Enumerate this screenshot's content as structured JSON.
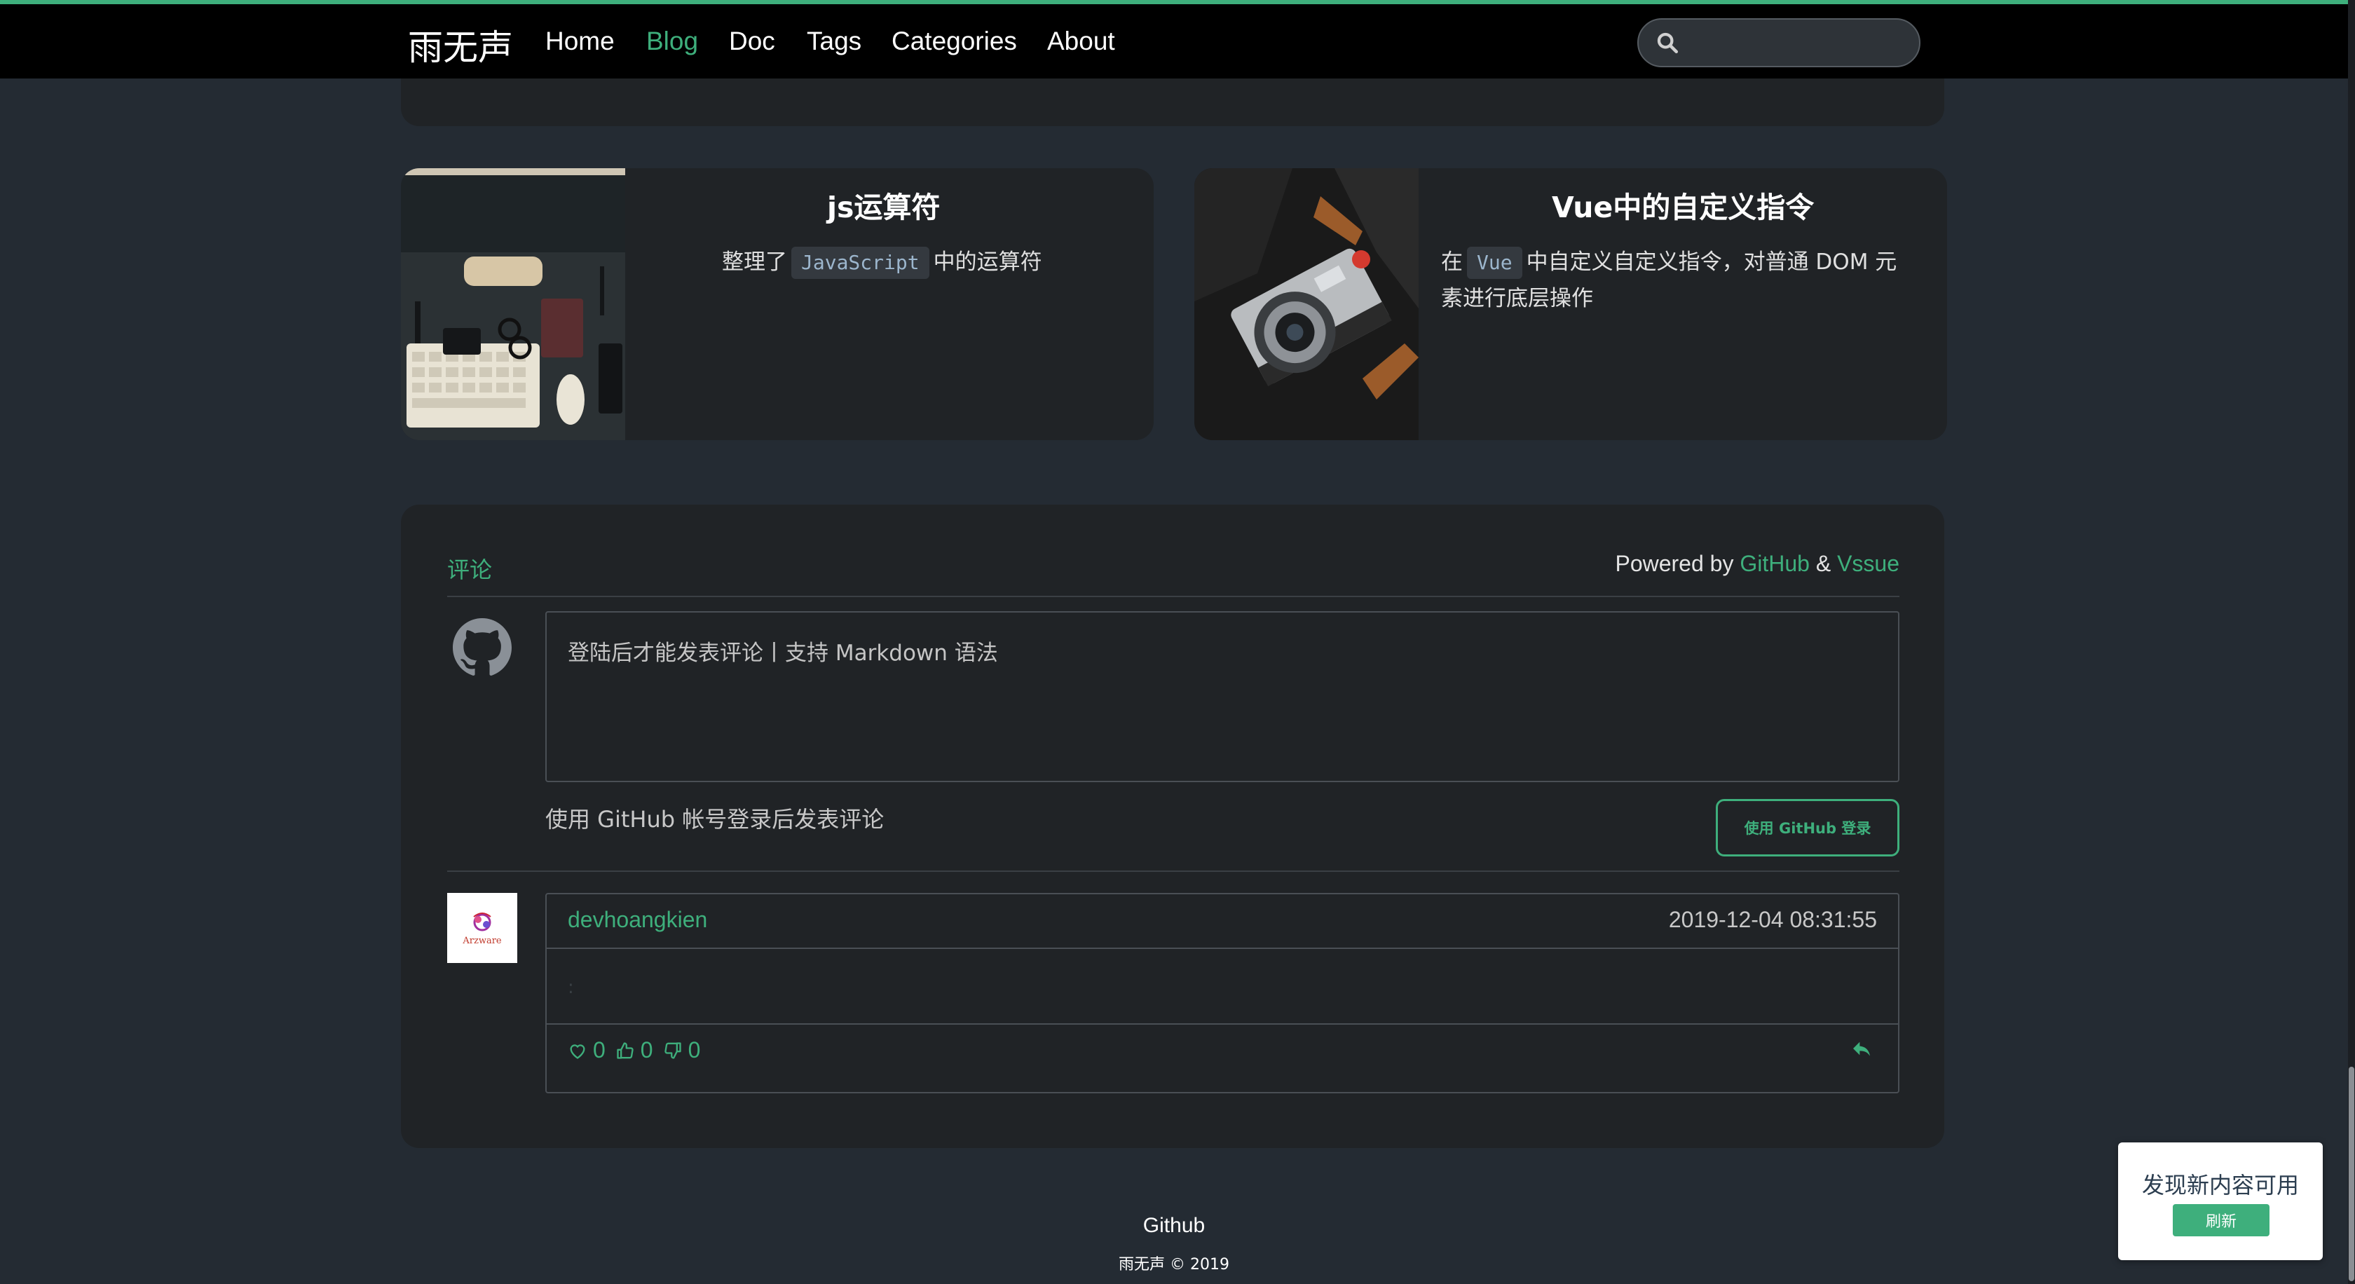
{
  "nav": {
    "brand": "雨无声",
    "links": [
      "Home",
      "Blog",
      "Doc",
      "Tags",
      "Categories",
      "About"
    ],
    "active": "Blog",
    "search_placeholder": ""
  },
  "posts": [
    {
      "title": "js运算符",
      "desc_before": "整理了",
      "code": "JavaScript",
      "desc_after": "中的运算符"
    },
    {
      "title": "Vue中的自定义指令",
      "desc_before": "在",
      "code": "Vue",
      "desc_after": "中自定义自定义指令，对普通 DOM 元素进行底层操作"
    }
  ],
  "comments": {
    "header": "评论",
    "powered_prefix": "Powered by",
    "powered_github": "GitHub",
    "powered_amp": "&",
    "powered_vssue": "Vssue",
    "textarea_placeholder": "登陆后才能发表评论丨支持 Markdown 语法",
    "tip": "使用 GitHub 帐号登录后发表评论",
    "login_button": "使用 GitHub 登录",
    "items": [
      {
        "author": "devhoangkien",
        "time": "2019-12-04 08:31:55",
        "body": ":",
        "hearts": "0",
        "likes": "0",
        "dislikes": "0",
        "avatar_text": "Arzware"
      }
    ]
  },
  "footer": {
    "link": "Github",
    "copyright": "雨无声 © 2019"
  },
  "toast": {
    "message": "发现新内容可用",
    "button": "刷新"
  },
  "colors": {
    "accent": "#3eaf7c",
    "background": "#242b33",
    "card": "#202326",
    "nav": "#000000"
  }
}
